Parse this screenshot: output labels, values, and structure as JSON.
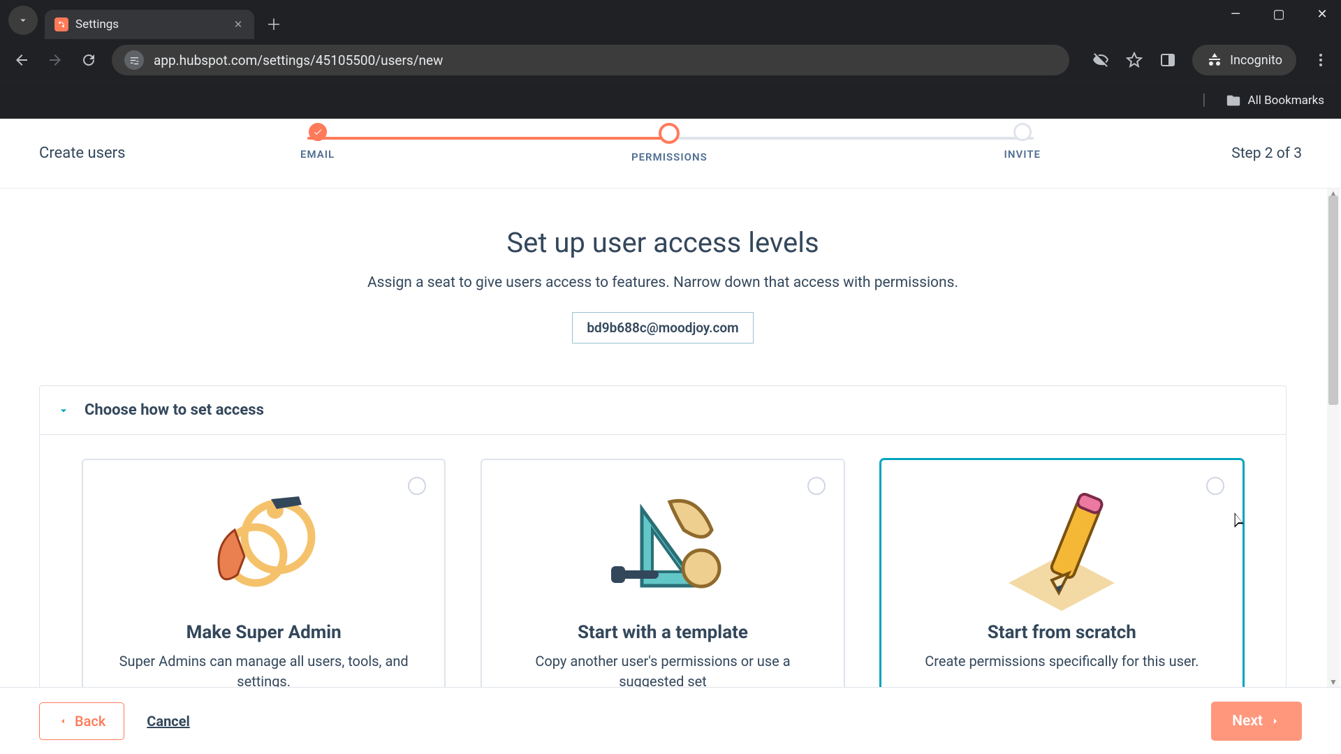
{
  "browser": {
    "tab_title": "Settings",
    "url": "app.hubspot.com/settings/45105500/users/new",
    "incognito_label": "Incognito",
    "all_bookmarks": "All Bookmarks"
  },
  "wizard": {
    "page_label": "Create users",
    "step_text": "Step 2 of 3",
    "steps": {
      "email": "EMAIL",
      "permissions": "PERMISSIONS",
      "invite": "INVITE"
    }
  },
  "header": {
    "title": "Set up user access levels",
    "subtitle": "Assign a seat to give users access to features. Narrow down that access with permissions.",
    "email_chip": "bd9b688c@moodjoy.com"
  },
  "accordion": {
    "label": "Choose how to set access"
  },
  "cards": {
    "super_admin": {
      "title": "Make Super Admin",
      "desc": "Super Admins can manage all users, tools, and settings."
    },
    "template": {
      "title": "Start with a template",
      "desc": "Copy another user's permissions or use a suggested set"
    },
    "scratch": {
      "title": "Start from scratch",
      "desc": "Create permissions specifically for this user."
    }
  },
  "footer": {
    "back": "Back",
    "cancel": "Cancel",
    "next": "Next"
  },
  "colors": {
    "accent": "#ff7a59",
    "brand_teal": "#00a4bd",
    "text": "#33475b"
  }
}
